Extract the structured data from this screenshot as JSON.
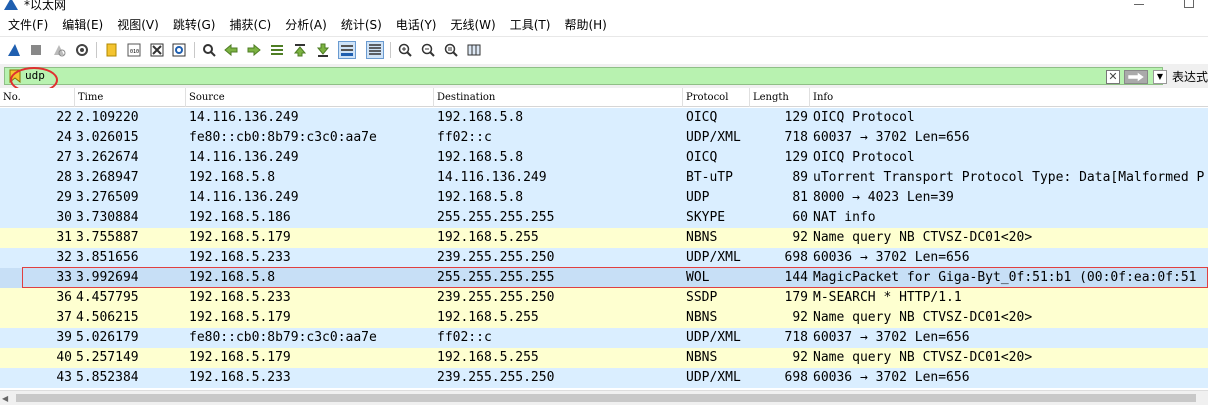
{
  "window": {
    "title": "*以太网"
  },
  "menu": {
    "items": [
      {
        "label": "文件(F)"
      },
      {
        "label": "编辑(E)"
      },
      {
        "label": "视图(V)"
      },
      {
        "label": "跳转(G)"
      },
      {
        "label": "捕获(C)"
      },
      {
        "label": "分析(A)"
      },
      {
        "label": "统计(S)"
      },
      {
        "label": "电话(Y)"
      },
      {
        "label": "无线(W)"
      },
      {
        "label": "工具(T)"
      },
      {
        "label": "帮助(H)"
      }
    ]
  },
  "toolbar": {
    "icons": [
      "shark-fin-start-icon",
      "stop-icon",
      "restart-icon",
      "capture-options-icon",
      "open-file-icon",
      "save-file-icon",
      "close-file-icon",
      "reload-icon",
      "find-icon",
      "go-back-icon",
      "go-forward-icon",
      "go-to-packet-icon",
      "go-first-icon",
      "go-last-icon",
      "autoscroll-icon",
      "colorize-icon",
      "zoom-in-icon",
      "zoom-out-icon",
      "zoom-normal-icon",
      "resize-columns-icon"
    ]
  },
  "filter": {
    "value": "udp",
    "expression_label": "表达式…",
    "clear_label": "✕",
    "dropdown_label": "▼",
    "bg_color": "#b8f2b0",
    "annotation_color": "#e03030"
  },
  "columns": {
    "no": "No.",
    "time": "Time",
    "source": "Source",
    "destination": "Destination",
    "protocol": "Protocol",
    "length": "Length",
    "info": "Info"
  },
  "packets": [
    {
      "no": "22",
      "time": "2.109220",
      "source": "14.116.136.249",
      "destination": "192.168.5.8",
      "protocol": "OICQ",
      "length": "129",
      "info": "OICQ Protocol",
      "color": "#daeeff"
    },
    {
      "no": "24",
      "time": "3.026015",
      "source": "fe80::cb0:8b79:c3c0:aa7e",
      "destination": "ff02::c",
      "protocol": "UDP/XML",
      "length": "718",
      "info": "60037 → 3702 Len=656",
      "color": "#daeeff"
    },
    {
      "no": "27",
      "time": "3.262674",
      "source": "14.116.136.249",
      "destination": "192.168.5.8",
      "protocol": "OICQ",
      "length": "129",
      "info": "OICQ Protocol",
      "color": "#daeeff"
    },
    {
      "no": "28",
      "time": "3.268947",
      "source": "192.168.5.8",
      "destination": "14.116.136.249",
      "protocol": "BT-uTP",
      "length": "89",
      "info": "uTorrent Transport Protocol Type: Data[Malformed P",
      "color": "#daeeff"
    },
    {
      "no": "29",
      "time": "3.276509",
      "source": "14.116.136.249",
      "destination": "192.168.5.8",
      "protocol": "UDP",
      "length": "81",
      "info": "8000 → 4023 Len=39",
      "color": "#daeeff"
    },
    {
      "no": "30",
      "time": "3.730884",
      "source": "192.168.5.186",
      "destination": "255.255.255.255",
      "protocol": "SKYPE",
      "length": "60",
      "info": "NAT info",
      "color": "#daeeff"
    },
    {
      "no": "31",
      "time": "3.755887",
      "source": "192.168.5.179",
      "destination": "192.168.5.255",
      "protocol": "NBNS",
      "length": "92",
      "info": "Name query NB CTVSZ-DC01<20>",
      "color": "#feffd0"
    },
    {
      "no": "32",
      "time": "3.851656",
      "source": "192.168.5.233",
      "destination": "239.255.255.250",
      "protocol": "UDP/XML",
      "length": "698",
      "info": "60036 → 3702 Len=656",
      "color": "#daeeff"
    },
    {
      "no": "33",
      "time": "3.992694",
      "source": "192.168.5.8",
      "destination": "255.255.255.255",
      "protocol": "WOL",
      "length": "144",
      "info": "MagicPacket for Giga-Byt_0f:51:b1 (00:0f:ea:0f:51",
      "color": "#c7dff6"
    },
    {
      "no": "36",
      "time": "4.457795",
      "source": "192.168.5.233",
      "destination": "239.255.255.250",
      "protocol": "SSDP",
      "length": "179",
      "info": "M-SEARCH * HTTP/1.1",
      "color": "#feffd0"
    },
    {
      "no": "37",
      "time": "4.506215",
      "source": "192.168.5.179",
      "destination": "192.168.5.255",
      "protocol": "NBNS",
      "length": "92",
      "info": "Name query NB CTVSZ-DC01<20>",
      "color": "#feffd0"
    },
    {
      "no": "39",
      "time": "5.026179",
      "source": "fe80::cb0:8b79:c3c0:aa7e",
      "destination": "ff02::c",
      "protocol": "UDP/XML",
      "length": "718",
      "info": "60037 → 3702 Len=656",
      "color": "#daeeff"
    },
    {
      "no": "40",
      "time": "5.257149",
      "source": "192.168.5.179",
      "destination": "192.168.5.255",
      "protocol": "NBNS",
      "length": "92",
      "info": "Name query NB CTVSZ-DC01<20>",
      "color": "#feffd0"
    },
    {
      "no": "43",
      "time": "5.852384",
      "source": "192.168.5.233",
      "destination": "239.255.255.250",
      "protocol": "UDP/XML",
      "length": "698",
      "info": "60036 → 3702 Len=656",
      "color": "#daeeff"
    }
  ],
  "highlighted_packet_no": "33",
  "highlight_color": "#e04040"
}
